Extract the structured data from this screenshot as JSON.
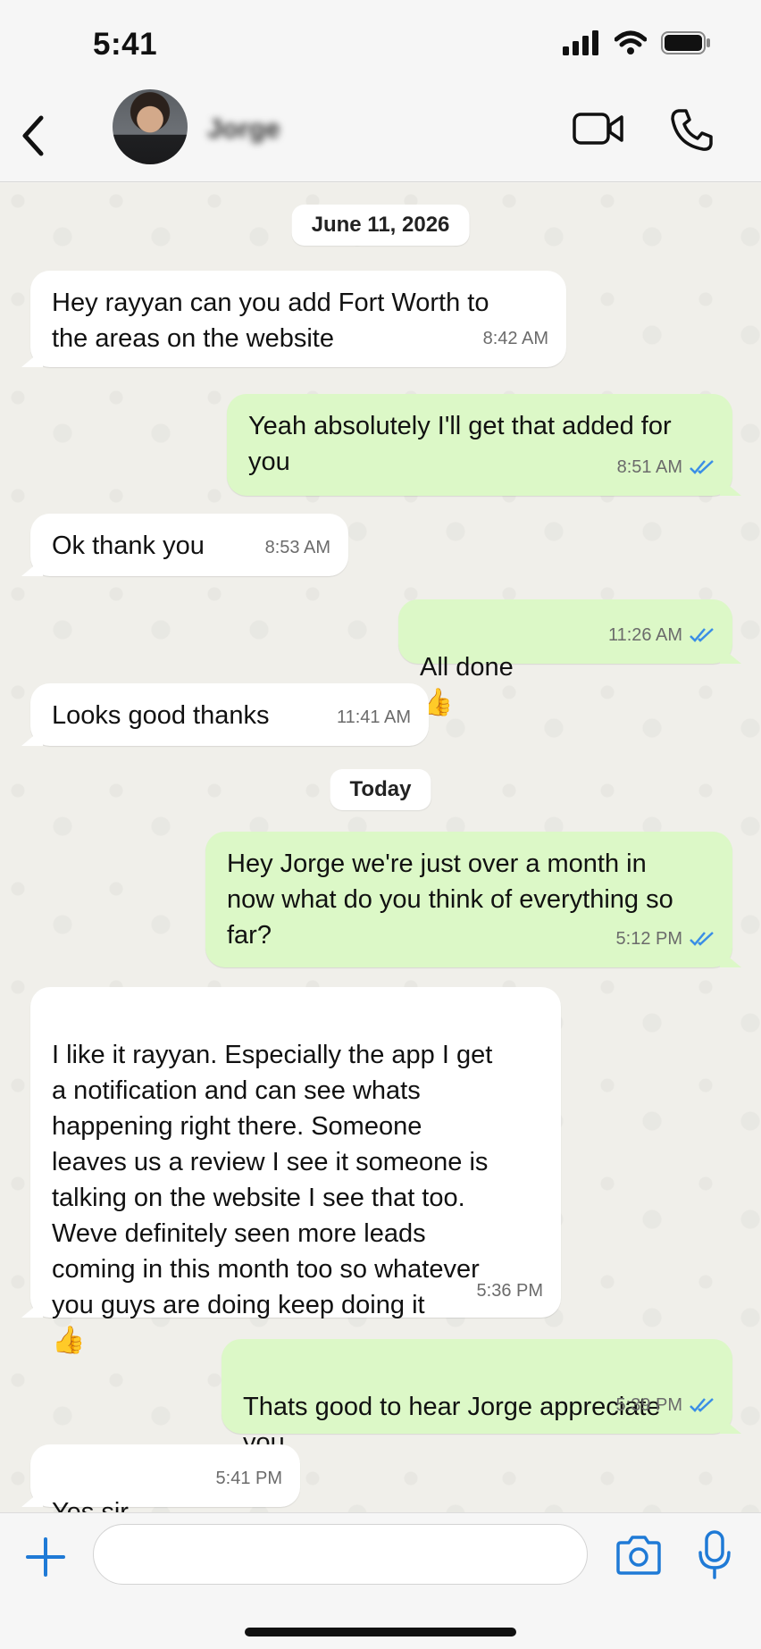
{
  "status_bar": {
    "time": "5:41"
  },
  "header": {
    "contact_name": "Jorge"
  },
  "messages": [
    {
      "type": "date",
      "text": "June 11, 2026"
    },
    {
      "type": "in",
      "text": "Hey rayyan can you add Fort Worth to\nthe areas on the website",
      "time": "8:42 AM"
    },
    {
      "type": "out",
      "text": "Yeah absolutely I'll get that added for\nyou",
      "time": "8:51 AM",
      "status": "read"
    },
    {
      "type": "in",
      "text": "Ok thank you",
      "time": "8:53 AM"
    },
    {
      "type": "out",
      "text": "All done",
      "emoji": "👍",
      "time": "11:26 AM",
      "status": "read"
    },
    {
      "type": "in",
      "text": "Looks good thanks",
      "time": "11:41 AM"
    },
    {
      "type": "date",
      "text": "Today"
    },
    {
      "type": "out",
      "text": "Hey Jorge we're just over a month in\nnow what do you think of everything so\nfar?",
      "time": "5:12 PM",
      "status": "read"
    },
    {
      "type": "in",
      "text": "I like it rayyan. Especially the app I get\na notification and can see whats\nhappening right there. Someone\nleaves us a review I see it someone is\ntalking on the website I see that too.\nWeve definitely seen more leads\ncoming in this month too so whatever\nyou guys are doing keep doing it",
      "emoji": "👍",
      "time": "5:36 PM"
    },
    {
      "type": "out",
      "text": "Thats good to hear Jorge appreciate\nyou",
      "emoji": "👍",
      "time": "5:39 PM",
      "status": "read"
    },
    {
      "type": "in",
      "text": "Yes sir",
      "emoji": "👍",
      "time": "5:41 PM"
    }
  ],
  "input": {
    "placeholder": ""
  },
  "colors": {
    "incoming_bubble": "#ffffff",
    "outgoing_bubble": "#dcf8c7",
    "read_tick": "#3a8ee6",
    "accent": "#1f7ad6"
  },
  "icons": [
    "back-icon",
    "video-call-icon",
    "voice-call-icon",
    "plus-icon",
    "camera-icon",
    "microphone-icon",
    "signal-icon",
    "wifi-icon",
    "battery-icon"
  ]
}
